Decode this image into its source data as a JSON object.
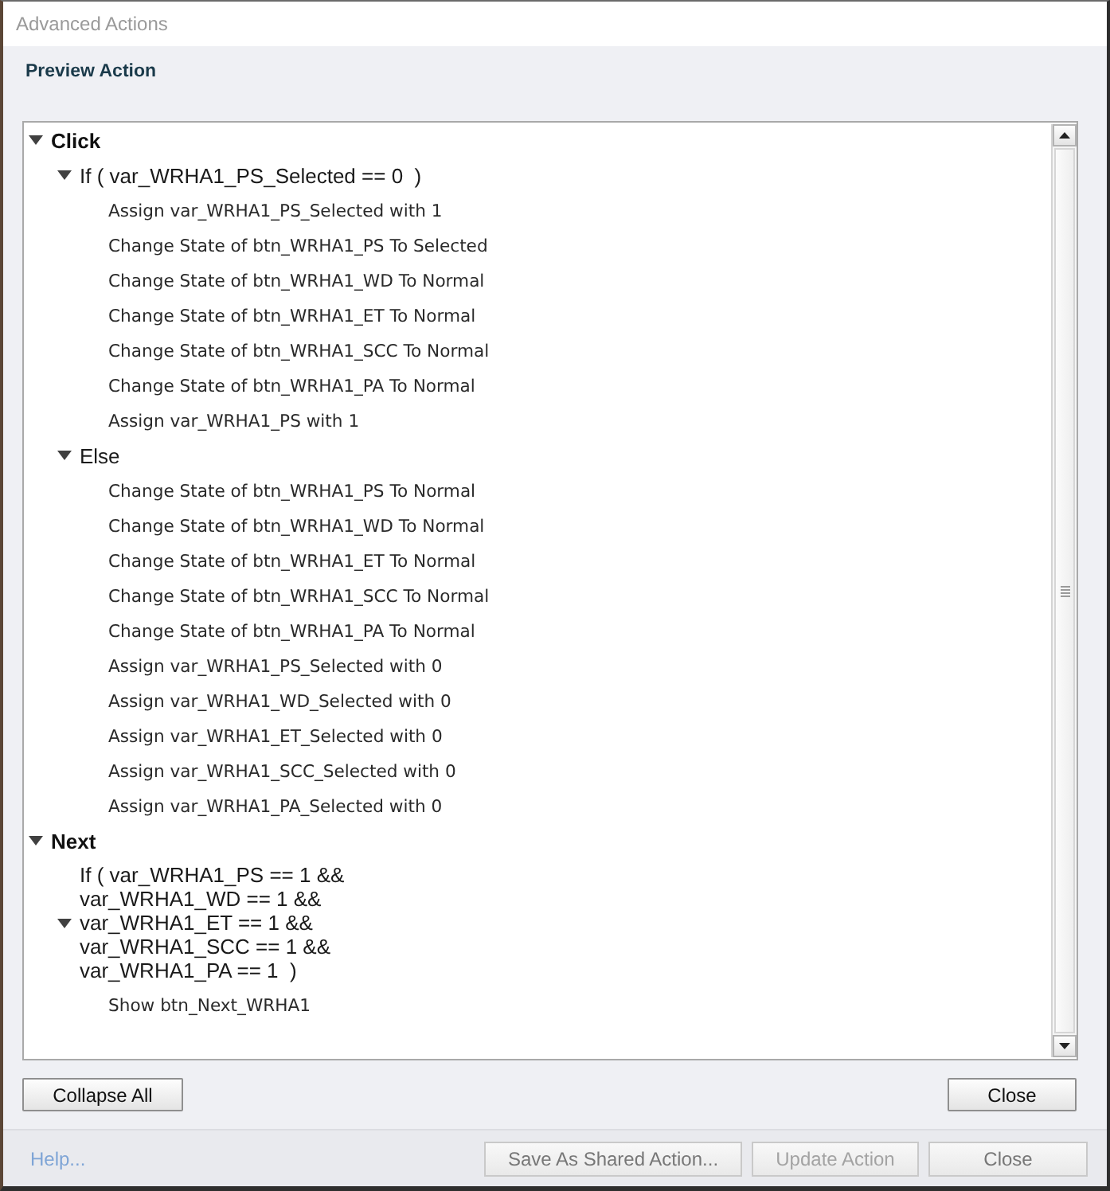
{
  "window": {
    "title": "Advanced Actions"
  },
  "section_title": "Preview Action",
  "tree": [
    {
      "label": "Click",
      "kind": "event",
      "expanded": true,
      "children": [
        {
          "label": "If ( var_WRHA1_PS_Selected == 0  )",
          "kind": "condition",
          "expanded": true,
          "children": [
            {
              "label": "Assign var_WRHA1_PS_Selected with 1",
              "kind": "action"
            },
            {
              "label": "Change State of btn_WRHA1_PS To Selected",
              "kind": "action"
            },
            {
              "label": "Change State of btn_WRHA1_WD To Normal",
              "kind": "action"
            },
            {
              "label": "Change State of btn_WRHA1_ET To Normal",
              "kind": "action"
            },
            {
              "label": "Change State of btn_WRHA1_SCC To Normal",
              "kind": "action"
            },
            {
              "label": "Change State of btn_WRHA1_PA To Normal",
              "kind": "action"
            },
            {
              "label": "Assign var_WRHA1_PS with 1",
              "kind": "action"
            }
          ]
        },
        {
          "label": "Else",
          "kind": "condition",
          "expanded": true,
          "children": [
            {
              "label": "Change State of btn_WRHA1_PS To Normal",
              "kind": "action"
            },
            {
              "label": "Change State of btn_WRHA1_WD To Normal",
              "kind": "action"
            },
            {
              "label": "Change State of btn_WRHA1_ET To Normal",
              "kind": "action"
            },
            {
              "label": "Change State of btn_WRHA1_SCC To Normal",
              "kind": "action"
            },
            {
              "label": "Change State of btn_WRHA1_PA To Normal",
              "kind": "action"
            },
            {
              "label": "Assign var_WRHA1_PS_Selected with 0",
              "kind": "action"
            },
            {
              "label": "Assign var_WRHA1_WD_Selected with 0",
              "kind": "action"
            },
            {
              "label": "Assign var_WRHA1_ET_Selected with 0",
              "kind": "action"
            },
            {
              "label": "Assign var_WRHA1_SCC_Selected with 0",
              "kind": "action"
            },
            {
              "label": "Assign var_WRHA1_PA_Selected with 0",
              "kind": "action"
            }
          ]
        }
      ]
    },
    {
      "label": "Next",
      "kind": "event",
      "expanded": true,
      "children": [
        {
          "label": "If ( var_WRHA1_PS == 1 &&\nvar_WRHA1_WD == 1 &&\nvar_WRHA1_ET == 1 &&\nvar_WRHA1_SCC == 1 &&\nvar_WRHA1_PA == 1  )",
          "kind": "condition",
          "expanded": true,
          "children": [
            {
              "label": "Show btn_Next_WRHA1",
              "kind": "action"
            }
          ]
        }
      ]
    }
  ],
  "panel_buttons": [
    {
      "label": "Collapse All"
    },
    {
      "label": "Close"
    }
  ],
  "footer": {
    "help_link": "Help...",
    "buttons": [
      {
        "label": "Save As Shared Action...",
        "disabled": false
      },
      {
        "label": "Update Action",
        "disabled": true
      },
      {
        "label": "Close",
        "disabled": false
      }
    ]
  }
}
